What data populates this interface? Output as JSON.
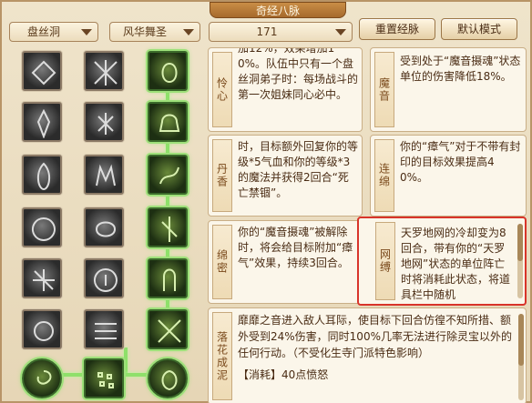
{
  "window": {
    "title": "奇经八脉"
  },
  "header": {
    "faction": "盘丝洞",
    "school": "风华舞圣",
    "points": "171",
    "reset_label": "重置经脉",
    "default_label": "默认模式"
  },
  "cards": [
    {
      "tag": "怜心",
      "text": "加12%，效果增加10%。队伍中只有一个盘丝洞弟子时：每场战斗的第一次姐妹同心必中。"
    },
    {
      "tag": "魔音",
      "text": "受到处于“魔音摄魂”状态单位的伤害降低18%。"
    },
    {
      "tag": "丹香",
      "text": "时，目标额外回复你的等级*5气血和你的等级*3的魔法并获得2回合“死亡禁锢”。"
    },
    {
      "tag": "连绵",
      "text": "你的“瘴气”对于不带有封印的目标效果提高40%。"
    },
    {
      "tag": "绵密",
      "text": "你的“魔音摄魂”被解除时，将会给目标附加“瘴气”效果，持续3回合。"
    },
    {
      "tag": "网缚",
      "text": "天罗地网的冷却变为8回合，带有你的“天罗地网”状态的单位阵亡时将消耗此状态，将道具栏中随机"
    },
    {
      "tag": "落花成泥",
      "text": "靡靡之音进入敌人耳际，使目标下回合仿徨不知所措、额外受到24%伤害，同时100%几率无法进行除灵宝以外的任何行动。（不受化生寺门派特色影响）",
      "cost": "【消耗】40点愤怒"
    }
  ],
  "colors": {
    "active_glow": "#8ee06a",
    "highlight_border": "#d8342a",
    "title_bg": "#b67838"
  },
  "icons": [
    "butterfly-icon",
    "web-icon",
    "moth-icon",
    "flame-icon",
    "spider-icon",
    "bell-icon",
    "fire-icon",
    "hand-icon",
    "smoke-icon",
    "web-sun-icon",
    "knot-icon",
    "vine-icon",
    "net-icon",
    "wheel-icon",
    "ghost-icon",
    "swirl-icon",
    "stripes-icon",
    "mesh-icon",
    "orb-icon",
    "seed-icon",
    "lotus-icon"
  ]
}
